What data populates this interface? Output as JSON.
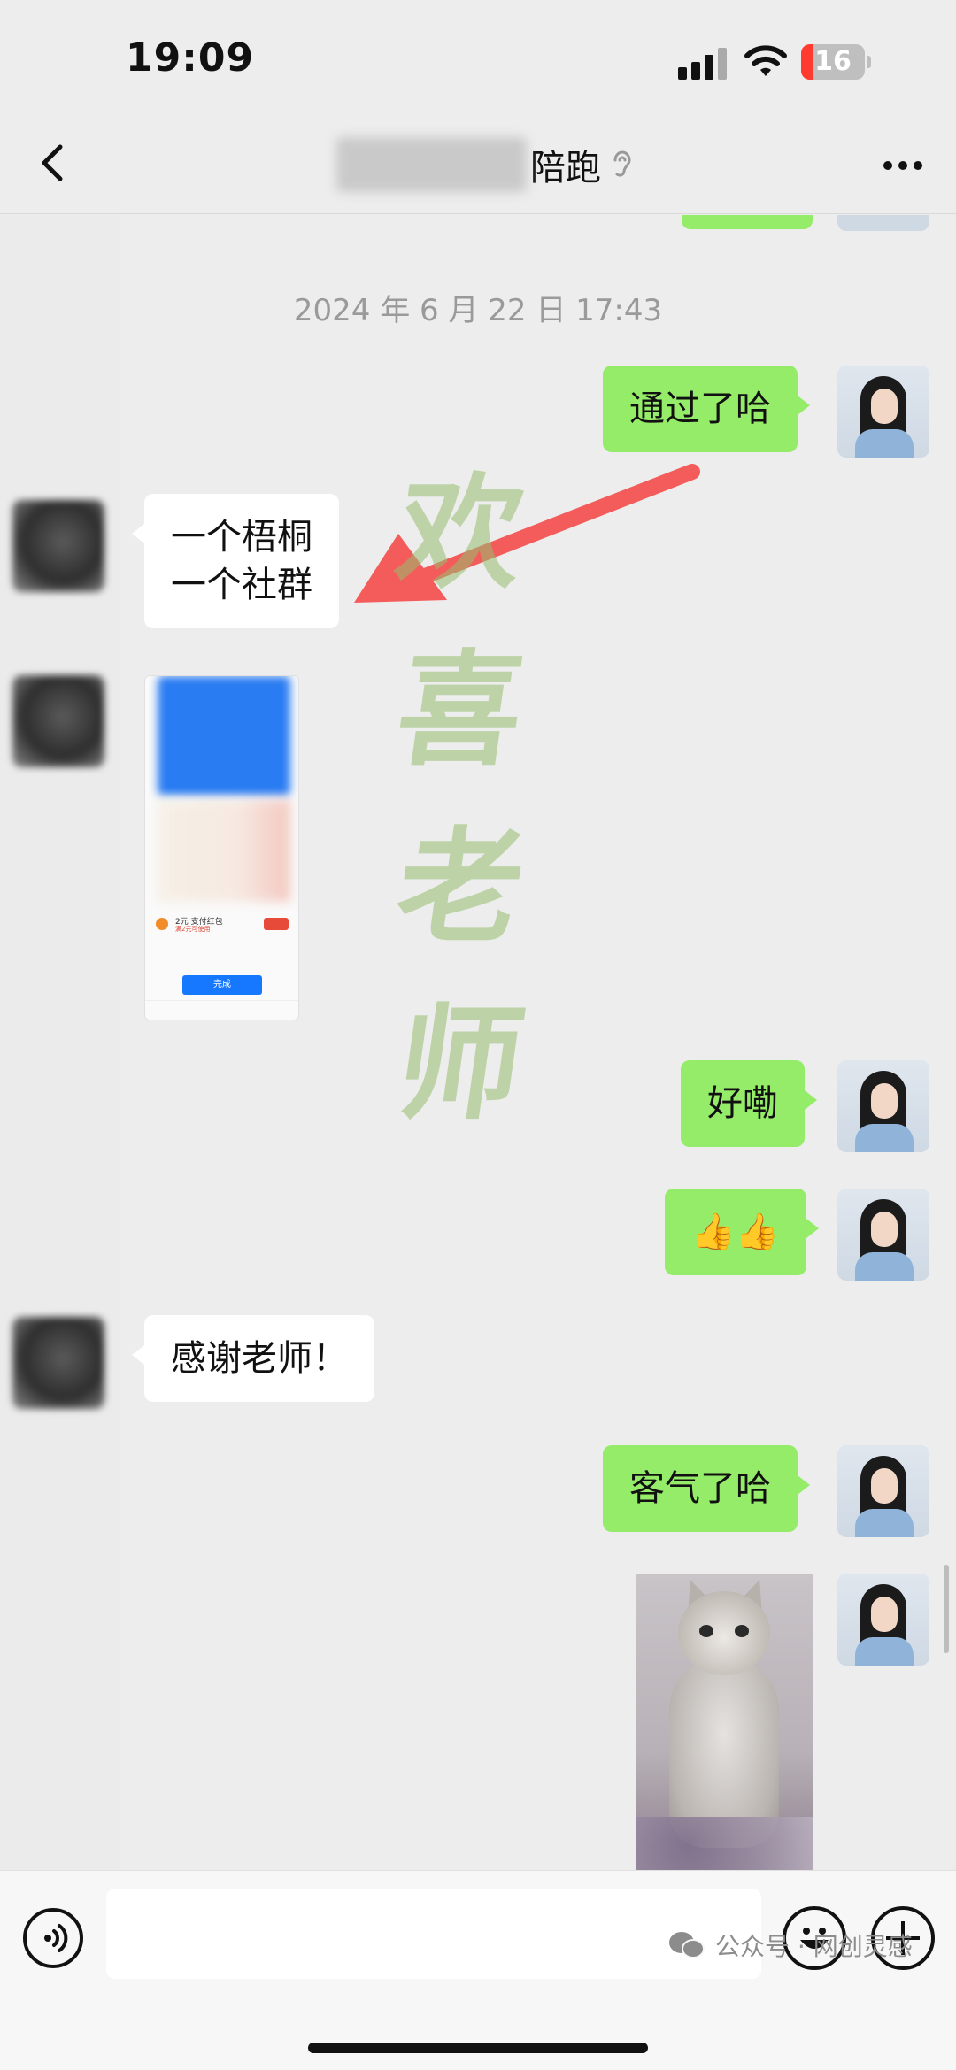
{
  "status_bar": {
    "time": "19:09",
    "battery": "16"
  },
  "nav": {
    "title": "陪跑"
  },
  "chat": {
    "timestamp": "2024 年 6 月 22 日 17:43",
    "messages": [
      {
        "from": "me",
        "text": "通过了哈"
      },
      {
        "from": "other",
        "lines": [
          "一个梧桐",
          "一个社群"
        ]
      },
      {
        "from": "other",
        "type": "image",
        "image_text": {
          "row_title": "2元 支付红包",
          "row_sub": "满2元可使用",
          "done": "完成"
        }
      },
      {
        "from": "me",
        "text": "好嘞"
      },
      {
        "from": "me",
        "text": "👍👍"
      },
      {
        "from": "other",
        "text": "感谢老师！"
      },
      {
        "from": "me",
        "text": "客气了哈"
      },
      {
        "from": "me",
        "type": "image"
      }
    ]
  },
  "watermark": [
    "欢",
    "喜",
    "老",
    "师"
  ],
  "input": {
    "placeholder": ""
  },
  "footer_mark": "公众号 · 网创灵感",
  "colors": {
    "sent_bubble": "#95ec69",
    "received_bubble": "#ffffff",
    "background": "#ededed"
  }
}
